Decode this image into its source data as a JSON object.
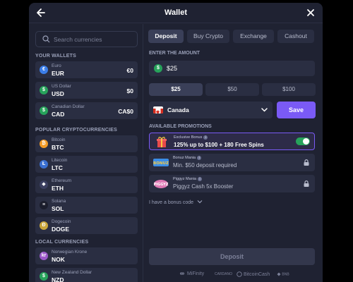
{
  "header": {
    "title": "Wallet",
    "back_icon": "arrow-left-icon",
    "close_icon": "close-icon"
  },
  "search": {
    "placeholder": "Search currencies"
  },
  "sections": {
    "wallets": "YOUR WALLETS",
    "crypto": "POPULAR CRYPTOCURRENCIES",
    "local": "LOCAL CURRENCIES"
  },
  "wallets": [
    {
      "name": "Euro",
      "code": "EUR",
      "balance": "€0",
      "icon": "€",
      "color": "#3b7de8"
    },
    {
      "name": "US Dollar",
      "code": "USD",
      "balance": "$0",
      "icon": "$",
      "color": "#27a35b"
    },
    {
      "name": "Canadian Dollar",
      "code": "CAD",
      "balance": "CA$0",
      "icon": "$",
      "color": "#27a35b"
    }
  ],
  "crypto": [
    {
      "name": "Bitcoin",
      "code": "BTC",
      "icon": "₿",
      "color": "#f29b26"
    },
    {
      "name": "Litecoin",
      "code": "LTC",
      "icon": "Ł",
      "color": "#3a6fd0"
    },
    {
      "name": "Ethereum",
      "code": "ETH",
      "icon": "◆",
      "color": "#3b3f60"
    },
    {
      "name": "Solana",
      "code": "SOL",
      "icon": "≡",
      "color": "#1b1d2c"
    },
    {
      "name": "Dogecoin",
      "code": "DOGE",
      "icon": "Ð",
      "color": "#c9a63b"
    }
  ],
  "local": [
    {
      "name": "Norwegian Krone",
      "code": "NOK",
      "icon": "kr",
      "color": "#9b59c9"
    },
    {
      "name": "New Zealand Dollar",
      "code": "NZD",
      "icon": "$",
      "color": "#27a35b"
    }
  ],
  "tabs": [
    "Deposit",
    "Buy Crypto",
    "Exchange",
    "Cashout"
  ],
  "active_tab": "Deposit",
  "amount": {
    "label": "ENTER THE AMOUNT",
    "value": "$25"
  },
  "quick_amounts": [
    "$25",
    "$50",
    "$100"
  ],
  "country": {
    "name": "Canada"
  },
  "save_label": "Save",
  "promotions": {
    "label": "AVAILABLE PROMOTIONS",
    "items": [
      {
        "tag": "Exclusive Bonus",
        "text": "125% up to $100 + 180 Free Spins",
        "selected": true
      },
      {
        "tag": "Bonuz Mania",
        "text": "Min. $50 deposit required",
        "selected": false
      },
      {
        "tag": "Piggyz Mania",
        "text": "Piggyz Cash 5x Booster",
        "selected": false
      }
    ]
  },
  "bonus_code_label": "I have a bonus code",
  "deposit_label": "Deposit",
  "payment_methods": [
    "MiFinity",
    "CARDANO",
    "BitcoinCash",
    "BNB"
  ],
  "colors": {
    "accent": "#7a5af5",
    "toggle": "#27a35b",
    "panel": "#1f2232",
    "row": "#2a2e42"
  }
}
